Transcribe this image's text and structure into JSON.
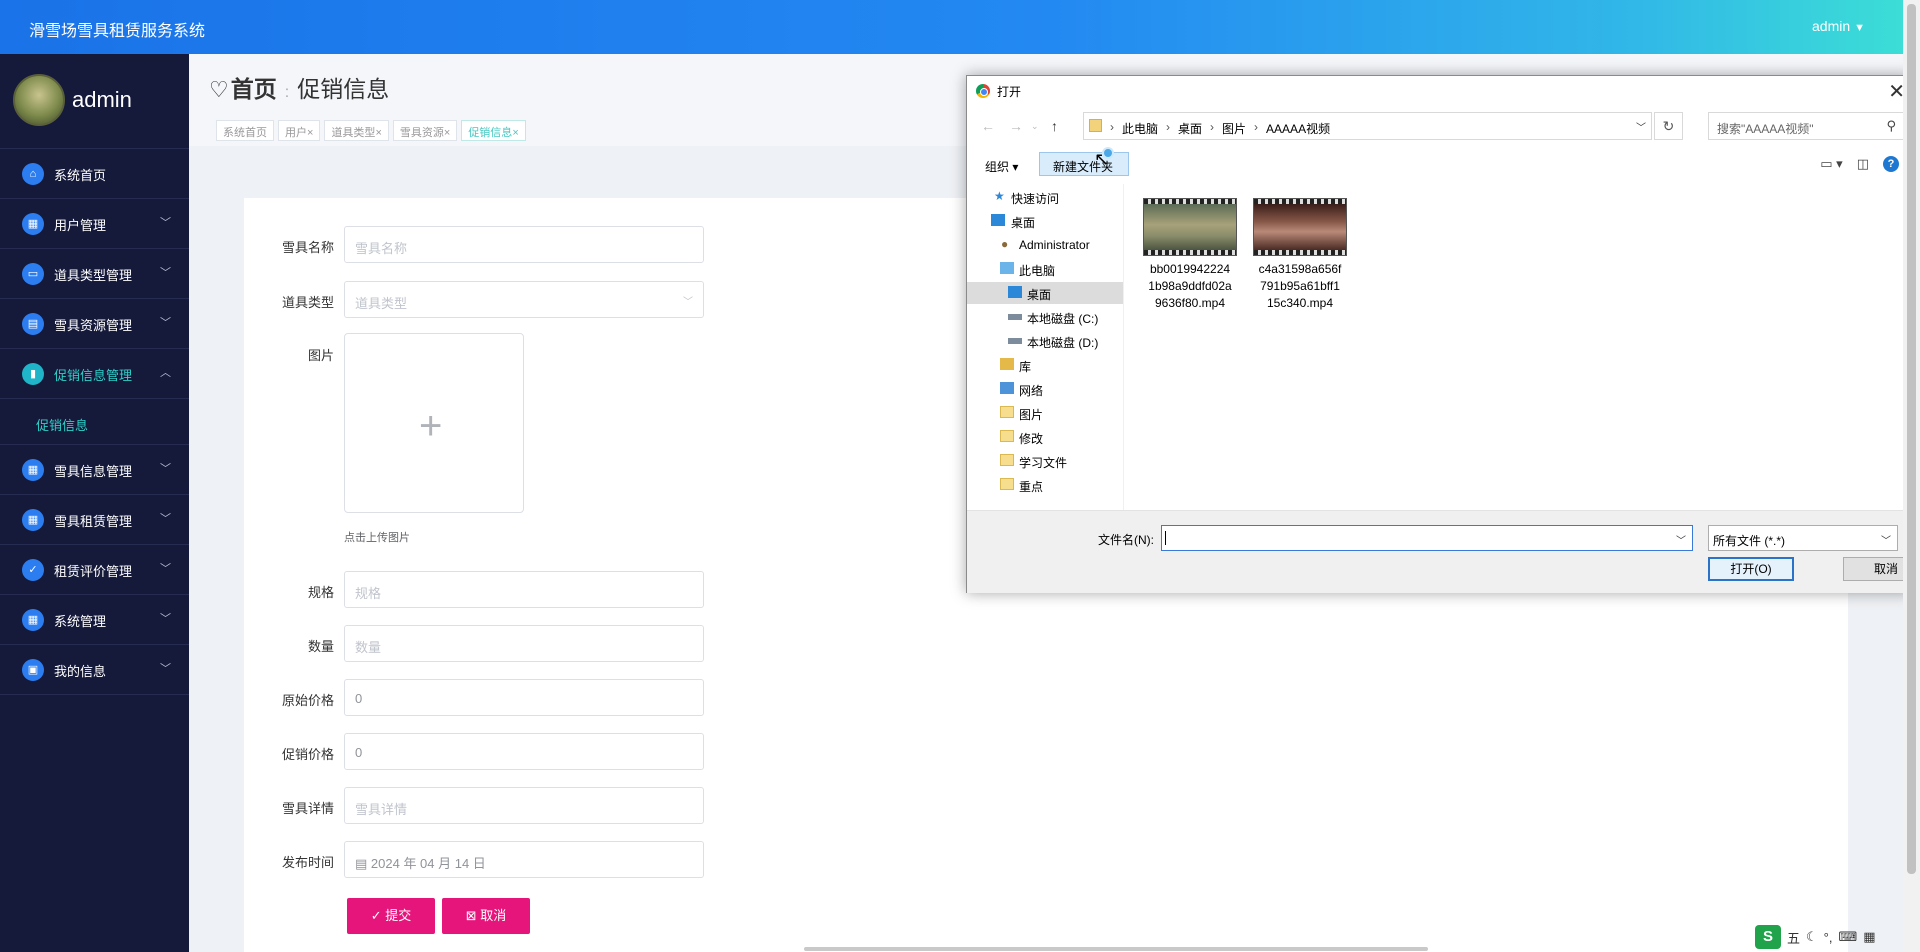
{
  "app": {
    "title": "滑雪场雪具租赁服务系统",
    "user": "admin"
  },
  "sidebar": {
    "profile_name": "admin",
    "items": [
      {
        "label": "系统首页",
        "icon": "home-icon"
      },
      {
        "label": "用户管理",
        "icon": "grid-icon"
      },
      {
        "label": "道具类型管理",
        "icon": "monitor-icon"
      },
      {
        "label": "雪具资源管理",
        "icon": "briefcase-icon"
      },
      {
        "label": "促销信息管理",
        "icon": "bar-chart-icon"
      },
      {
        "label": "雪具信息管理",
        "icon": "grid-icon"
      },
      {
        "label": "雪具租赁管理",
        "icon": "grid-icon"
      },
      {
        "label": "租赁评价管理",
        "icon": "thumb-icon"
      },
      {
        "label": "系统管理",
        "icon": "grid-icon"
      },
      {
        "label": "我的信息",
        "icon": "card-icon"
      }
    ],
    "submenu": "促销信息"
  },
  "breadcrumb": {
    "home": "首页",
    "current": "促销信息"
  },
  "tabs": [
    {
      "label": "系统首页"
    },
    {
      "label": "用户"
    },
    {
      "label": "道具类型"
    },
    {
      "label": "雪具资源"
    },
    {
      "label": "促销信息"
    }
  ],
  "form": {
    "name": {
      "label": "雪具名称",
      "placeholder": "雪具名称"
    },
    "type": {
      "label": "道具类型",
      "placeholder": "道具类型"
    },
    "image": {
      "label": "图片",
      "hint": "点击上传图片"
    },
    "spec": {
      "label": "规格",
      "placeholder": "规格"
    },
    "qty": {
      "label": "数量",
      "placeholder": "数量"
    },
    "orig_price": {
      "label": "原始价格",
      "value": "0"
    },
    "promo_price": {
      "label": "促销价格",
      "value": "0"
    },
    "detail": {
      "label": "雪具详情",
      "placeholder": "雪具详情"
    },
    "time": {
      "label": "发布时间",
      "value": "2024 年 04 月 14 日"
    },
    "submit": "提交",
    "cancel": "取消"
  },
  "dialog": {
    "title": "打开",
    "path": [
      "此电脑",
      "桌面",
      "图片",
      "AAAAA视频"
    ],
    "search_placeholder": "搜索\"AAAAA视频\"",
    "organize": "组织",
    "new_folder": "新建文件夹",
    "tree": [
      {
        "label": "快速访问"
      },
      {
        "label": "桌面"
      },
      {
        "label": "Administrator"
      },
      {
        "label": "此电脑"
      },
      {
        "label": "桌面"
      },
      {
        "label": "本地磁盘 (C:)"
      },
      {
        "label": "本地磁盘 (D:)"
      },
      {
        "label": "库"
      },
      {
        "label": "网络"
      },
      {
        "label": "图片"
      },
      {
        "label": "修改"
      },
      {
        "label": "学习文件"
      },
      {
        "label": "重点"
      }
    ],
    "files": [
      {
        "line1": "bb0019942224",
        "line2": "1b98a9ddfd02a",
        "line3": "9636f80.mp4"
      },
      {
        "line1": "c4a31598a656f",
        "line2": "791b95a61bff1",
        "line3": "15c340.mp4"
      }
    ],
    "filename_label": "文件名(N):",
    "filetype": "所有文件 (*.*)",
    "open_btn": "打开(O)",
    "cancel_btn": "取消"
  },
  "ime": {
    "text": "五"
  }
}
